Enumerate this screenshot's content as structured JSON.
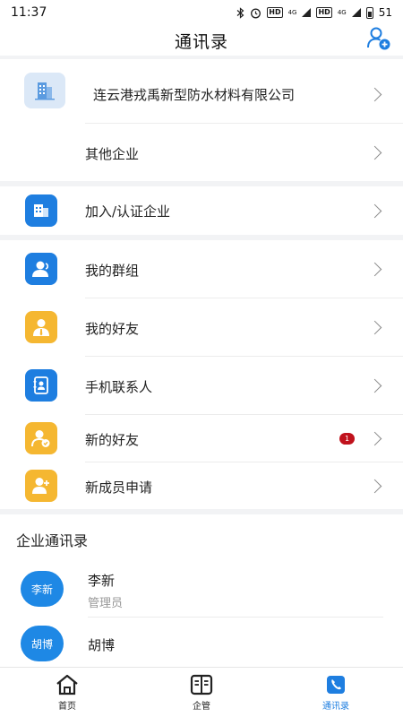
{
  "status_bar": {
    "time": "11:37",
    "network_left": "4G",
    "network_right": "4G",
    "hd_label": "HD",
    "battery": "51"
  },
  "header": {
    "title": "通讯录",
    "action_icon": "add-contact-icon"
  },
  "companies": [
    {
      "label": "连云港戎禹新型防水材料有限公司",
      "icon": "building-logo-icon"
    },
    {
      "label": "其他企业"
    }
  ],
  "join": {
    "label": "加入/认证企业",
    "icon": "building-icon"
  },
  "menu": [
    {
      "label": "我的群组",
      "icon": "group-icon"
    },
    {
      "label": "我的好友",
      "icon": "friend-icon"
    },
    {
      "label": "手机联系人",
      "icon": "phone-book-icon"
    },
    {
      "label": "新的好友",
      "icon": "new-friend-icon",
      "badge": "1"
    },
    {
      "label": "新成员申请",
      "icon": "member-apply-icon"
    }
  ],
  "directory": {
    "title": "企业通讯录",
    "members": [
      {
        "avatar": "李新",
        "name": "李新",
        "role": "管理员"
      },
      {
        "avatar": "胡博",
        "name": "胡博"
      }
    ]
  },
  "tabs": [
    {
      "label": "首页",
      "icon": "home-icon"
    },
    {
      "label": "企管",
      "icon": "book-icon"
    },
    {
      "label": "通讯录",
      "icon": "phone-icon",
      "active": true
    }
  ],
  "colors": {
    "accent": "#1e7ee0",
    "yellow": "#f5b731",
    "badge": "#c0121c",
    "avatar": "#1e88e5"
  }
}
